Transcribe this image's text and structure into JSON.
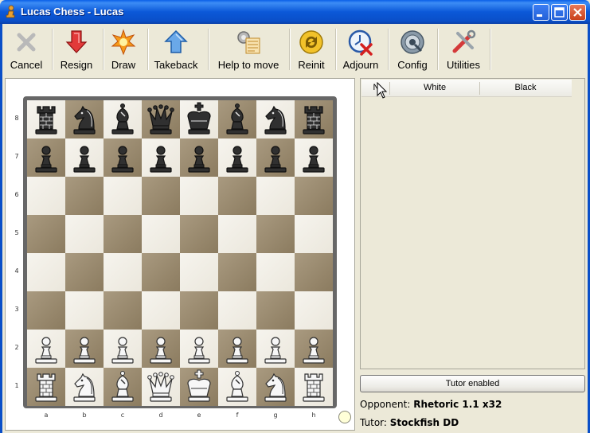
{
  "window": {
    "title": "Lucas Chess - Lucas"
  },
  "toolbar": [
    {
      "id": "cancel",
      "label": "Cancel",
      "icon": "cancel-icon"
    },
    {
      "id": "resign",
      "label": "Resign",
      "icon": "resign-icon"
    },
    {
      "id": "draw",
      "label": "Draw",
      "icon": "draw-icon"
    },
    {
      "id": "takeback",
      "label": "Takeback",
      "icon": "takeback-icon"
    },
    {
      "id": "help",
      "label": "Help to move",
      "icon": "help-to-move-icon"
    },
    {
      "id": "reinit",
      "label": "Reinit",
      "icon": "reinit-icon"
    },
    {
      "id": "adjourn",
      "label": "Adjourn",
      "icon": "adjourn-icon"
    },
    {
      "id": "config",
      "label": "Config",
      "icon": "config-icon"
    },
    {
      "id": "utilities",
      "label": "Utilities",
      "icon": "utilities-icon"
    }
  ],
  "board": {
    "ranks": [
      "8",
      "7",
      "6",
      "5",
      "4",
      "3",
      "2",
      "1"
    ],
    "files": [
      "a",
      "b",
      "c",
      "d",
      "e",
      "f",
      "g",
      "h"
    ],
    "position": [
      [
        "br",
        "bn",
        "bb",
        "bq",
        "bk",
        "bb",
        "bn",
        "br"
      ],
      [
        "bp",
        "bp",
        "bp",
        "bp",
        "bp",
        "bp",
        "bp",
        "bp"
      ],
      [
        "",
        "",
        "",
        "",
        "",
        "",
        "",
        ""
      ],
      [
        "",
        "",
        "",
        "",
        "",
        "",
        "",
        ""
      ],
      [
        "",
        "",
        "",
        "",
        "",
        "",
        "",
        ""
      ],
      [
        "",
        "",
        "",
        "",
        "",
        "",
        "",
        ""
      ],
      [
        "wp",
        "wp",
        "wp",
        "wp",
        "wp",
        "wp",
        "wp",
        "wp"
      ],
      [
        "wr",
        "wn",
        "wb",
        "wq",
        "wk",
        "wb",
        "wn",
        "wr"
      ]
    ]
  },
  "moves": {
    "columns": [
      "N",
      "White",
      "Black"
    ]
  },
  "tutor_button": {
    "label": "Tutor enabled"
  },
  "opponent": {
    "label": "Opponent:",
    "value": "Rhetoric 1.1 x32"
  },
  "tutor": {
    "label": "Tutor:",
    "value": "Stockfish DD"
  }
}
